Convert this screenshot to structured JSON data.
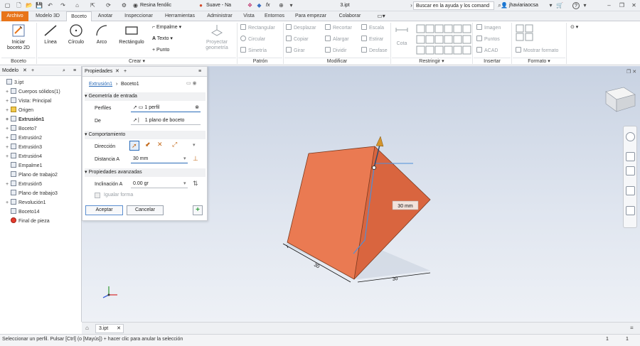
{
  "titlebar": {
    "material": "Resina fenólic",
    "appearance": "Suave - Na",
    "fx": "fx",
    "filename": "3.ipt",
    "help_search": "Buscar en la ayuda y los comand",
    "user": "jhaviariaocsa",
    "help_icon": "?"
  },
  "tabs": [
    "Archivo",
    "Modelo 3D",
    "Boceto",
    "Anotar",
    "Inspeccionar",
    "Herramientas",
    "Administrar",
    "Vista",
    "Entornos",
    "Para empezar",
    "Colaborar"
  ],
  "active_tab": "Boceto",
  "ribbon": {
    "start_sketch": "Iniciar\nboceto 2D",
    "start_sketch_l1": "Iniciar",
    "start_sketch_l2": "boceto 2D",
    "line": "Línea",
    "circle": "Círculo",
    "arc": "Arco",
    "rectangle": "Rectángulo",
    "fillet": "Empalme",
    "text": "Texto",
    "point": "Punto",
    "project_geo_l1": "Proyectar",
    "project_geo_l2": "geometría",
    "pattern_rect": "Rectangular",
    "pattern_circ": "Circular",
    "pattern_sym": "Simetría",
    "mod_move": "Desplazar",
    "mod_copy": "Copiar",
    "mod_rotate": "Girar",
    "mod_trim": "Recortar",
    "mod_extend": "Alargar",
    "mod_split": "Dividir",
    "mod_scale": "Escala",
    "mod_stretch": "Estirar",
    "mod_offset": "Desfase",
    "constraint_dim": "Cota",
    "ins_image": "Imagen",
    "ins_points": "Puntos",
    "ins_acad": "ACAD",
    "show_format": "Mostrar formato",
    "groups": {
      "sketch": "Boceto",
      "create": "Crear",
      "pattern": "Patrón",
      "modify": "Modificar",
      "constrain": "Restringir",
      "insert": "Insertar",
      "format": "Formato"
    }
  },
  "model_panel": {
    "title": "Modelo",
    "items": [
      {
        "label": "3.ipt",
        "indent": 0,
        "bold": false,
        "toggle": ""
      },
      {
        "label": "Cuerpos sólidos(1)",
        "indent": 1,
        "bold": false,
        "toggle": "+"
      },
      {
        "label": "Vista: Principal",
        "indent": 1,
        "bold": false,
        "toggle": "+"
      },
      {
        "label": "Origen",
        "indent": 1,
        "bold": false,
        "toggle": "+"
      },
      {
        "label": "Extrusión1",
        "indent": 1,
        "bold": true,
        "toggle": "+"
      },
      {
        "label": "Boceto7",
        "indent": 1,
        "bold": false,
        "toggle": "+"
      },
      {
        "label": "Extrusión2",
        "indent": 1,
        "bold": false,
        "toggle": "+"
      },
      {
        "label": "Extrusión3",
        "indent": 1,
        "bold": false,
        "toggle": "+"
      },
      {
        "label": "Extrusión4",
        "indent": 1,
        "bold": false,
        "toggle": "+"
      },
      {
        "label": "Empalme1",
        "indent": 1,
        "bold": false,
        "toggle": ""
      },
      {
        "label": "Plano de trabajo2",
        "indent": 1,
        "bold": false,
        "toggle": ""
      },
      {
        "label": "Extrusión5",
        "indent": 1,
        "bold": false,
        "toggle": "+"
      },
      {
        "label": "Plano de trabajo3",
        "indent": 1,
        "bold": false,
        "toggle": ""
      },
      {
        "label": "Revolución1",
        "indent": 1,
        "bold": false,
        "toggle": "+"
      },
      {
        "label": "Boceto14",
        "indent": 1,
        "bold": false,
        "toggle": ""
      },
      {
        "label": "Final de pieza",
        "indent": 1,
        "bold": false,
        "toggle": ""
      }
    ]
  },
  "properties": {
    "title": "Propiedades",
    "breadcrumb_feature": "Extrusión1",
    "breadcrumb_sketch": "Boceto1",
    "sec_input": "Geometría de entrada",
    "profiles_label": "Perfiles",
    "profiles_value": "1 perfil",
    "from_label": "De",
    "from_value": "1 plano de boceto",
    "sec_behavior": "Comportamiento",
    "direction_label": "Dirección",
    "distance_label": "Distancia A",
    "distance_value": "30 mm",
    "sec_advanced": "Propiedades avanzadas",
    "taper_label": "Inclinación A",
    "taper_value": "0.00 gr",
    "match_shape": "Igualar forma",
    "ok": "Aceptar",
    "cancel": "Cancelar",
    "add": "+"
  },
  "viewport": {
    "dimension_label": "30 mm",
    "dim_bottom_left": "30",
    "dim_bottom_right": "30",
    "colors": {
      "box_front": "#e8764f",
      "box_top": "#f08a5f",
      "box_side": "#d5613b",
      "edge": "#7a3a1f"
    }
  },
  "doc_tab": "3.ipt",
  "status": {
    "message": "Seleccionar un perfil. Pulsar [Ctrl] (o [Mayús]) + hacer clic para anular la selección",
    "count1": "1",
    "count2": "1"
  }
}
